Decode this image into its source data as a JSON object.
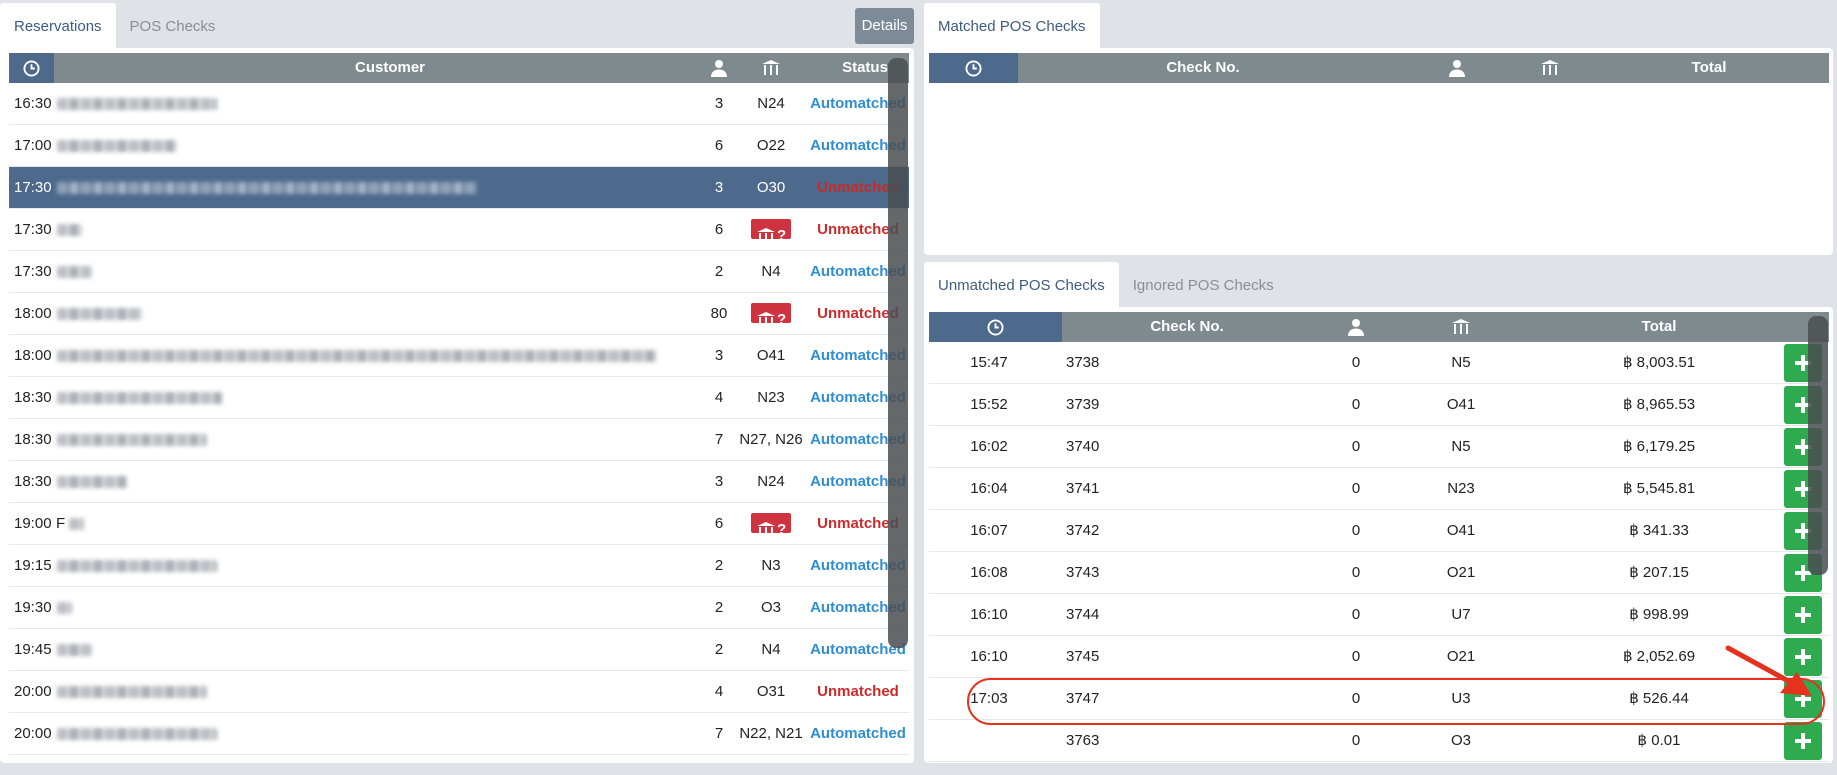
{
  "left_panel": {
    "tabs": [
      {
        "label": "Reservations"
      },
      {
        "label": "POS Checks"
      }
    ],
    "details_label": "Details",
    "headers": {
      "customer": "Customer",
      "status": "Status"
    },
    "rows": [
      {
        "time": "16:30",
        "guests": "3",
        "table": "N24",
        "status": "Automatched",
        "name": ""
      },
      {
        "time": "17:00",
        "guests": "6",
        "table": "O22",
        "status": "Automatched",
        "name": ""
      },
      {
        "time": "17:30",
        "guests": "3",
        "table": "O30",
        "status": "Unmatched",
        "name": ""
      },
      {
        "time": "17:30",
        "guests": "6",
        "table": "",
        "status": "Unmatched",
        "name": ""
      },
      {
        "time": "17:30",
        "guests": "2",
        "table": "N4",
        "status": "Automatched",
        "name": ""
      },
      {
        "time": "18:00",
        "guests": "80",
        "table": "",
        "status": "Unmatched",
        "name": ""
      },
      {
        "time": "18:00",
        "guests": "3",
        "table": "O41",
        "status": "Automatched",
        "name": ""
      },
      {
        "time": "18:30",
        "guests": "4",
        "table": "N23",
        "status": "Automatched",
        "name": ""
      },
      {
        "time": "18:30",
        "guests": "7",
        "table": "N27, N26",
        "status": "Automatched",
        "name": ""
      },
      {
        "time": "18:30",
        "guests": "3",
        "table": "N24",
        "status": "Automatched",
        "name": ""
      },
      {
        "time": "19:00",
        "guests": "6",
        "table": "",
        "status": "Unmatched",
        "name": "F"
      },
      {
        "time": "19:15",
        "guests": "2",
        "table": "N3",
        "status": "Automatched",
        "name": ""
      },
      {
        "time": "19:30",
        "guests": "2",
        "table": "O3",
        "status": "Automatched",
        "name": ""
      },
      {
        "time": "19:45",
        "guests": "2",
        "table": "N4",
        "status": "Automatched",
        "name": ""
      },
      {
        "time": "20:00",
        "guests": "4",
        "table": "O31",
        "status": "Unmatched",
        "name": ""
      },
      {
        "time": "20:00",
        "guests": "7",
        "table": "N22, N21",
        "status": "Automatched",
        "name": ""
      }
    ]
  },
  "matched_panel": {
    "tab_label": "Matched POS Checks",
    "headers": {
      "check_no": "Check No.",
      "total": "Total"
    }
  },
  "unmatched_panel": {
    "tabs": [
      {
        "label": "Unmatched POS Checks"
      },
      {
        "label": "Ignored POS Checks"
      }
    ],
    "headers": {
      "check_no": "Check No.",
      "total": "Total"
    },
    "rows": [
      {
        "time": "15:47",
        "check_no": "3738",
        "guests": "0",
        "table": "N5",
        "total": "฿ 8,003.51"
      },
      {
        "time": "15:52",
        "check_no": "3739",
        "guests": "0",
        "table": "O41",
        "total": "฿ 8,965.53"
      },
      {
        "time": "16:02",
        "check_no": "3740",
        "guests": "0",
        "table": "N5",
        "total": "฿ 6,179.25"
      },
      {
        "time": "16:04",
        "check_no": "3741",
        "guests": "0",
        "table": "N23",
        "total": "฿ 5,545.81"
      },
      {
        "time": "16:07",
        "check_no": "3742",
        "guests": "0",
        "table": "O41",
        "total": "฿ 341.33"
      },
      {
        "time": "16:08",
        "check_no": "3743",
        "guests": "0",
        "table": "O21",
        "total": "฿ 207.15"
      },
      {
        "time": "16:10",
        "check_no": "3744",
        "guests": "0",
        "table": "U7",
        "total": "฿ 998.99"
      },
      {
        "time": "16:10",
        "check_no": "3745",
        "guests": "0",
        "table": "O21",
        "total": "฿ 2,052.69"
      },
      {
        "time": "17:03",
        "check_no": "3747",
        "guests": "0",
        "table": "U3",
        "total": "฿ 526.44"
      },
      {
        "time": "",
        "check_no": "3763",
        "guests": "0",
        "table": "O3",
        "total": "฿ 0.01"
      }
    ]
  },
  "colors": {
    "accent_blue": "#4d6a8c",
    "header_gray": "#7f8a8f",
    "automatched": "#2f8ed3",
    "unmatched": "#cf2a2a",
    "add_green": "#2eaa4f",
    "annotation_red": "#e5321e"
  },
  "icons": {
    "clock": "clock-icon",
    "guests": "person-icon",
    "table": "table-icon",
    "no_table": "table-question-icon",
    "add": "plus-icon",
    "annotation": "red-arrow-icon"
  }
}
